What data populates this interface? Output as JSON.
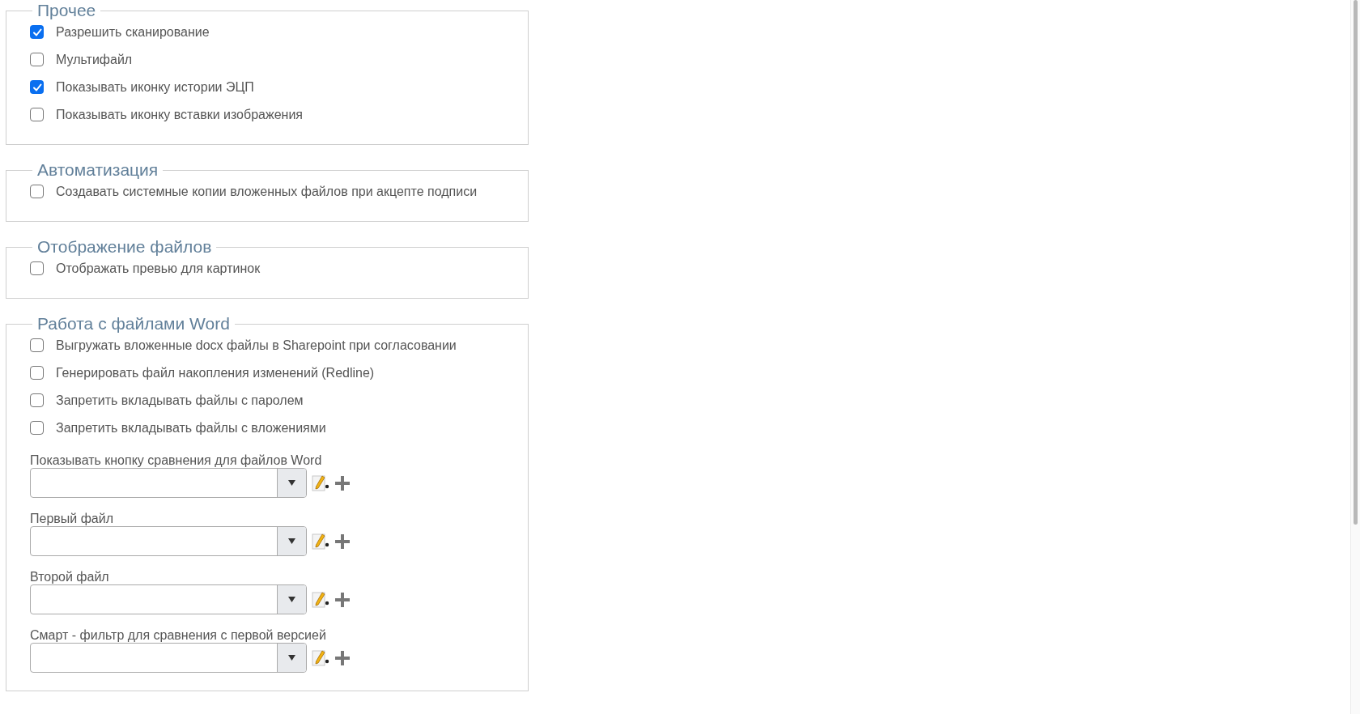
{
  "sections": [
    {
      "title": "Прочее",
      "items": [
        {
          "kind": "checkbox",
          "label": "Разрешить сканирование",
          "checked": true
        },
        {
          "kind": "checkbox",
          "label": "Мультифайл",
          "checked": false
        },
        {
          "kind": "checkbox",
          "label": "Показывать иконку истории ЭЦП",
          "checked": true
        },
        {
          "kind": "checkbox",
          "label": "Показывать иконку вставки изображения",
          "checked": false
        }
      ]
    },
    {
      "title": "Автоматизация",
      "items": [
        {
          "kind": "checkbox",
          "label": "Создавать системные копии вложенных файлов при акцепте подписи",
          "checked": false
        }
      ]
    },
    {
      "title": "Отображение файлов",
      "items": [
        {
          "kind": "checkbox",
          "label": "Отображать превью для картинок",
          "checked": false
        }
      ]
    },
    {
      "title": "Работа с файлами Word",
      "items": [
        {
          "kind": "checkbox",
          "label": "Выгружать вложенные docx файлы в Sharepoint при согласовании",
          "checked": false
        },
        {
          "kind": "checkbox",
          "label": "Генерировать файл накопления изменений (Redline)",
          "checked": false
        },
        {
          "kind": "checkbox",
          "label": "Запретить вкладывать файлы с паролем",
          "checked": false
        },
        {
          "kind": "checkbox",
          "label": "Запретить вкладывать файлы с вложениями",
          "checked": false
        },
        {
          "kind": "select",
          "label": "Показывать кнопку сравнения для файлов Word"
        },
        {
          "kind": "select",
          "label": "Первый файл"
        },
        {
          "kind": "select",
          "label": "Второй файл"
        },
        {
          "kind": "select",
          "label": "Смарт - фильтр для сравнения с первой версией"
        }
      ]
    }
  ]
}
